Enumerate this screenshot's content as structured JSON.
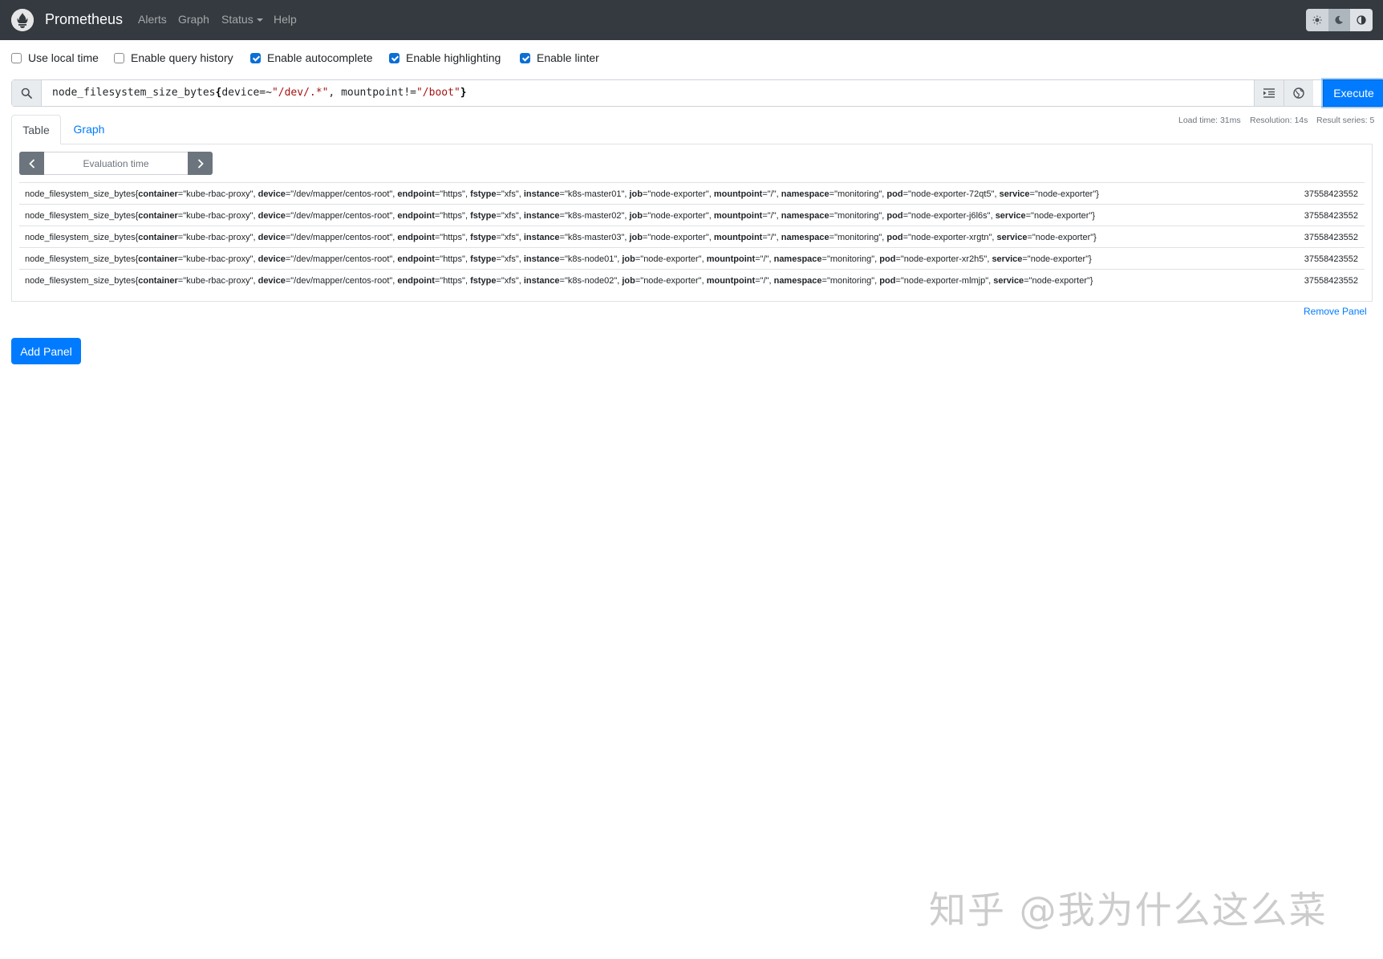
{
  "navbar": {
    "brand": "Prometheus",
    "links": {
      "alerts": "Alerts",
      "graph": "Graph",
      "status": "Status",
      "help": "Help"
    },
    "theme_icons": [
      "sun-icon",
      "moon-icon",
      "contrast-icon"
    ]
  },
  "options": {
    "use_local_time": {
      "label": "Use local time",
      "checked": false
    },
    "query_history": {
      "label": "Enable query history",
      "checked": false
    },
    "autocomplete": {
      "label": "Enable autocomplete",
      "checked": true
    },
    "highlighting": {
      "label": "Enable highlighting",
      "checked": true
    },
    "linter": {
      "label": "Enable linter",
      "checked": true
    }
  },
  "query": {
    "metric": "node_filesystem_size_bytes",
    "open_brace": "{",
    "label1": "device=~",
    "str1": "\"/dev/.*\"",
    "sep": ", ",
    "label2": "mountpoint!=",
    "str2": "\"/boot\"",
    "close_brace": "}",
    "execute_label": "Execute"
  },
  "stats": {
    "load_time": "Load time: 31ms",
    "resolution": "Resolution: 14s",
    "result_series": "Result series: 5"
  },
  "tabs": {
    "table": "Table",
    "graph": "Graph"
  },
  "evaluation": {
    "placeholder": "Evaluation time"
  },
  "results": [
    {
      "instance": "k8s-master01",
      "pod": "node-exporter-72qt5",
      "value": "37558423552"
    },
    {
      "instance": "k8s-master02",
      "pod": "node-exporter-j6l6s",
      "value": "37558423552"
    },
    {
      "instance": "k8s-master03",
      "pod": "node-exporter-xrgtn",
      "value": "37558423552"
    },
    {
      "instance": "k8s-node01",
      "pod": "node-exporter-xr2h5",
      "value": "37558423552"
    },
    {
      "instance": "k8s-node02",
      "pod": "node-exporter-mlmjp",
      "value": "37558423552"
    }
  ],
  "series_common": {
    "metric": "node_filesystem_size_bytes{",
    "container_k": "container",
    "container_v": "=\"kube-rbac-proxy\", ",
    "device_k": "device",
    "device_v": "=\"/dev/mapper/centos-root\", ",
    "endpoint_k": "endpoint",
    "endpoint_v": "=\"https\", ",
    "fstype_k": "fstype",
    "fstype_v": "=\"xfs\", ",
    "instance_k": "instance",
    "job_k": "job",
    "job_v": "=\"node-exporter\", ",
    "mountpoint_k": "mountpoint",
    "mountpoint_v": "=\"/\", ",
    "namespace_k": "namespace",
    "namespace_v": "=\"monitoring\", ",
    "pod_k": "pod",
    "service_k": "service",
    "service_v": "=\"node-exporter\"}"
  },
  "remove_panel": "Remove Panel",
  "add_panel": "Add Panel",
  "watermark": "知乎 @我为什么这么菜"
}
